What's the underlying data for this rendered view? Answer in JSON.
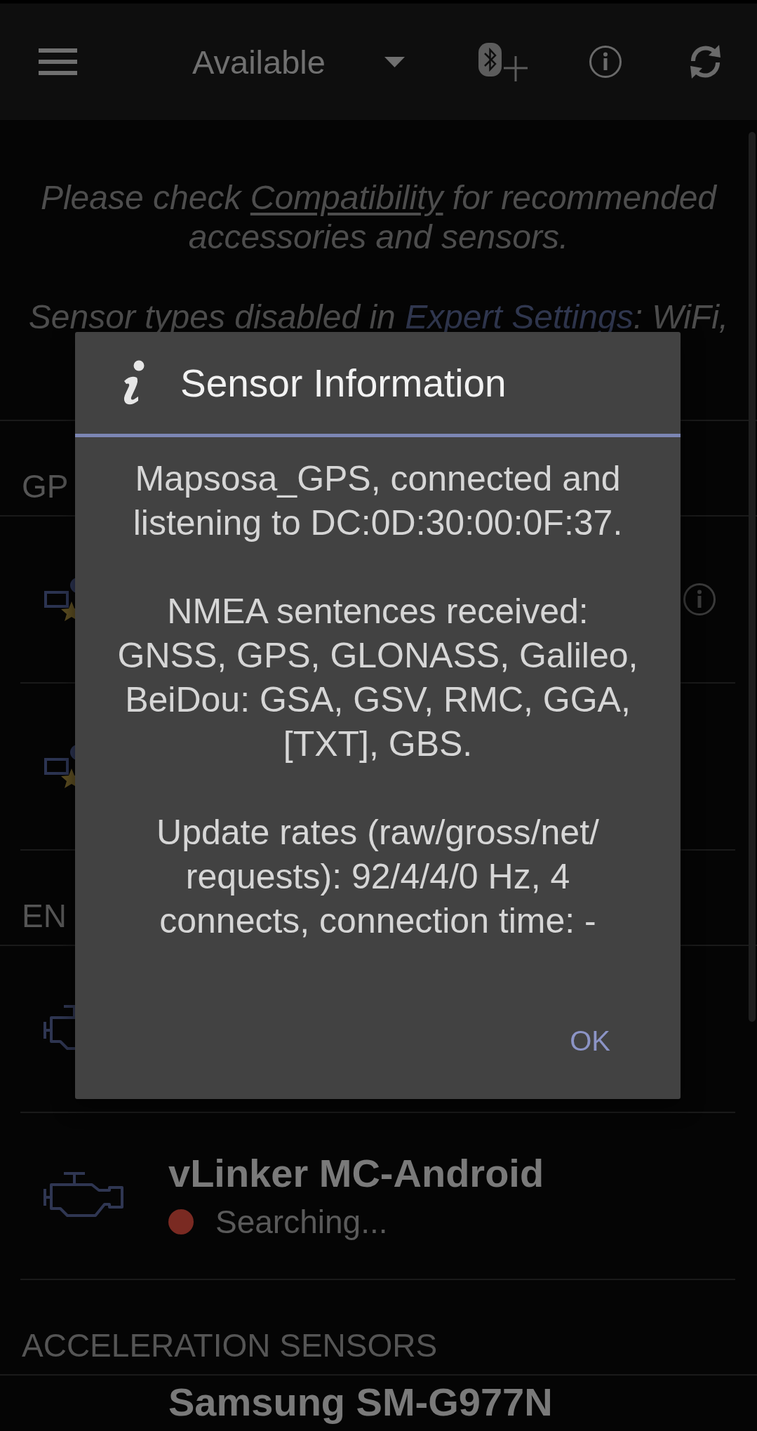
{
  "top_bar": {
    "dropdown": {
      "value": "Available"
    }
  },
  "notices": [
    {
      "before": "Please check ",
      "link": "Compatibility",
      "kind": "underlined",
      "after": " for recommended accessories and sensors."
    },
    {
      "before": "Sensor types disabled in ",
      "link": "Expert Settings",
      "kind": "accent",
      "after": ": WiFi,"
    }
  ],
  "sections": [
    {
      "title": "GP",
      "items": [
        {
          "kind": "gps",
          "info": true
        },
        {
          "kind": "gps"
        }
      ]
    },
    {
      "title": "EN",
      "items": [
        {
          "kind": "engine"
        },
        {
          "kind": "engine",
          "name": "vLinker MC-Android",
          "status": "Searching...",
          "color": "#7a2a22"
        }
      ]
    },
    {
      "title": "ACCELERATION SENSORS",
      "items": [
        {
          "kind": "phone",
          "name": "Samsung SM-G977N"
        }
      ]
    }
  ],
  "dialog": {
    "title": "Sensor Information",
    "paragraphs": [
      [
        "Mapsosa_GPS, connected and",
        "listening to DC:0D:30:00:0F:37."
      ],
      [
        "NMEA sentences received:",
        "GNSS, GPS, GLONASS, Galileo,",
        "BeiDou: GSA, GSV, RMC, GGA,",
        "[TXT], GBS."
      ],
      [
        "Update rates (raw/gross/net/",
        "requests): 92/4/4/0 Hz, 4",
        "connects, connection time: -"
      ]
    ],
    "buttons": [
      "OK"
    ]
  }
}
